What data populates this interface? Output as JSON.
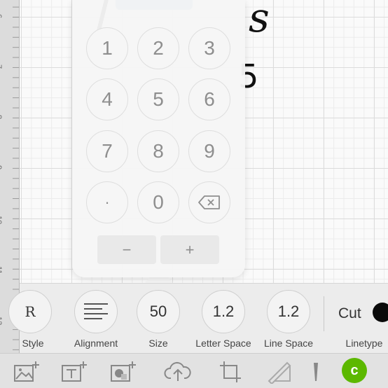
{
  "ruler": {
    "labels": [
      "6",
      "7",
      "8",
      "9",
      "10",
      "11",
      "12"
    ]
  },
  "design": {
    "text_fragment_right": "s",
    "text_fragment_small": "5"
  },
  "keypad": {
    "keys": [
      "1",
      "2",
      "3",
      "4",
      "5",
      "6",
      "7",
      "8",
      "9",
      "·",
      "0"
    ],
    "backspace_icon": "backspace-icon",
    "minus_label": "−",
    "plus_label": "+"
  },
  "text_toolbar": {
    "style": {
      "value": "R",
      "label": "Style"
    },
    "alignment": {
      "icon": "align-left-icon",
      "label": "Alignment"
    },
    "size": {
      "value": "50",
      "label": "Size"
    },
    "letter_space": {
      "value": "1.2",
      "label": "Letter Space"
    },
    "line_space": {
      "value": "1.2",
      "label": "Line Space"
    },
    "linetype": {
      "value": "Cut",
      "label": "Linetype",
      "color": "#0a0a0a"
    }
  },
  "action_bar": {
    "icons": [
      "add-image-icon",
      "add-text-icon",
      "add-shape-icon",
      "upload-icon",
      "crop-icon",
      "ruler-pen-icon",
      "edit-icon"
    ],
    "go_button_icon": "cricut-c-icon",
    "go_button_color": "#5cb800",
    "go_button_label": "c"
  }
}
